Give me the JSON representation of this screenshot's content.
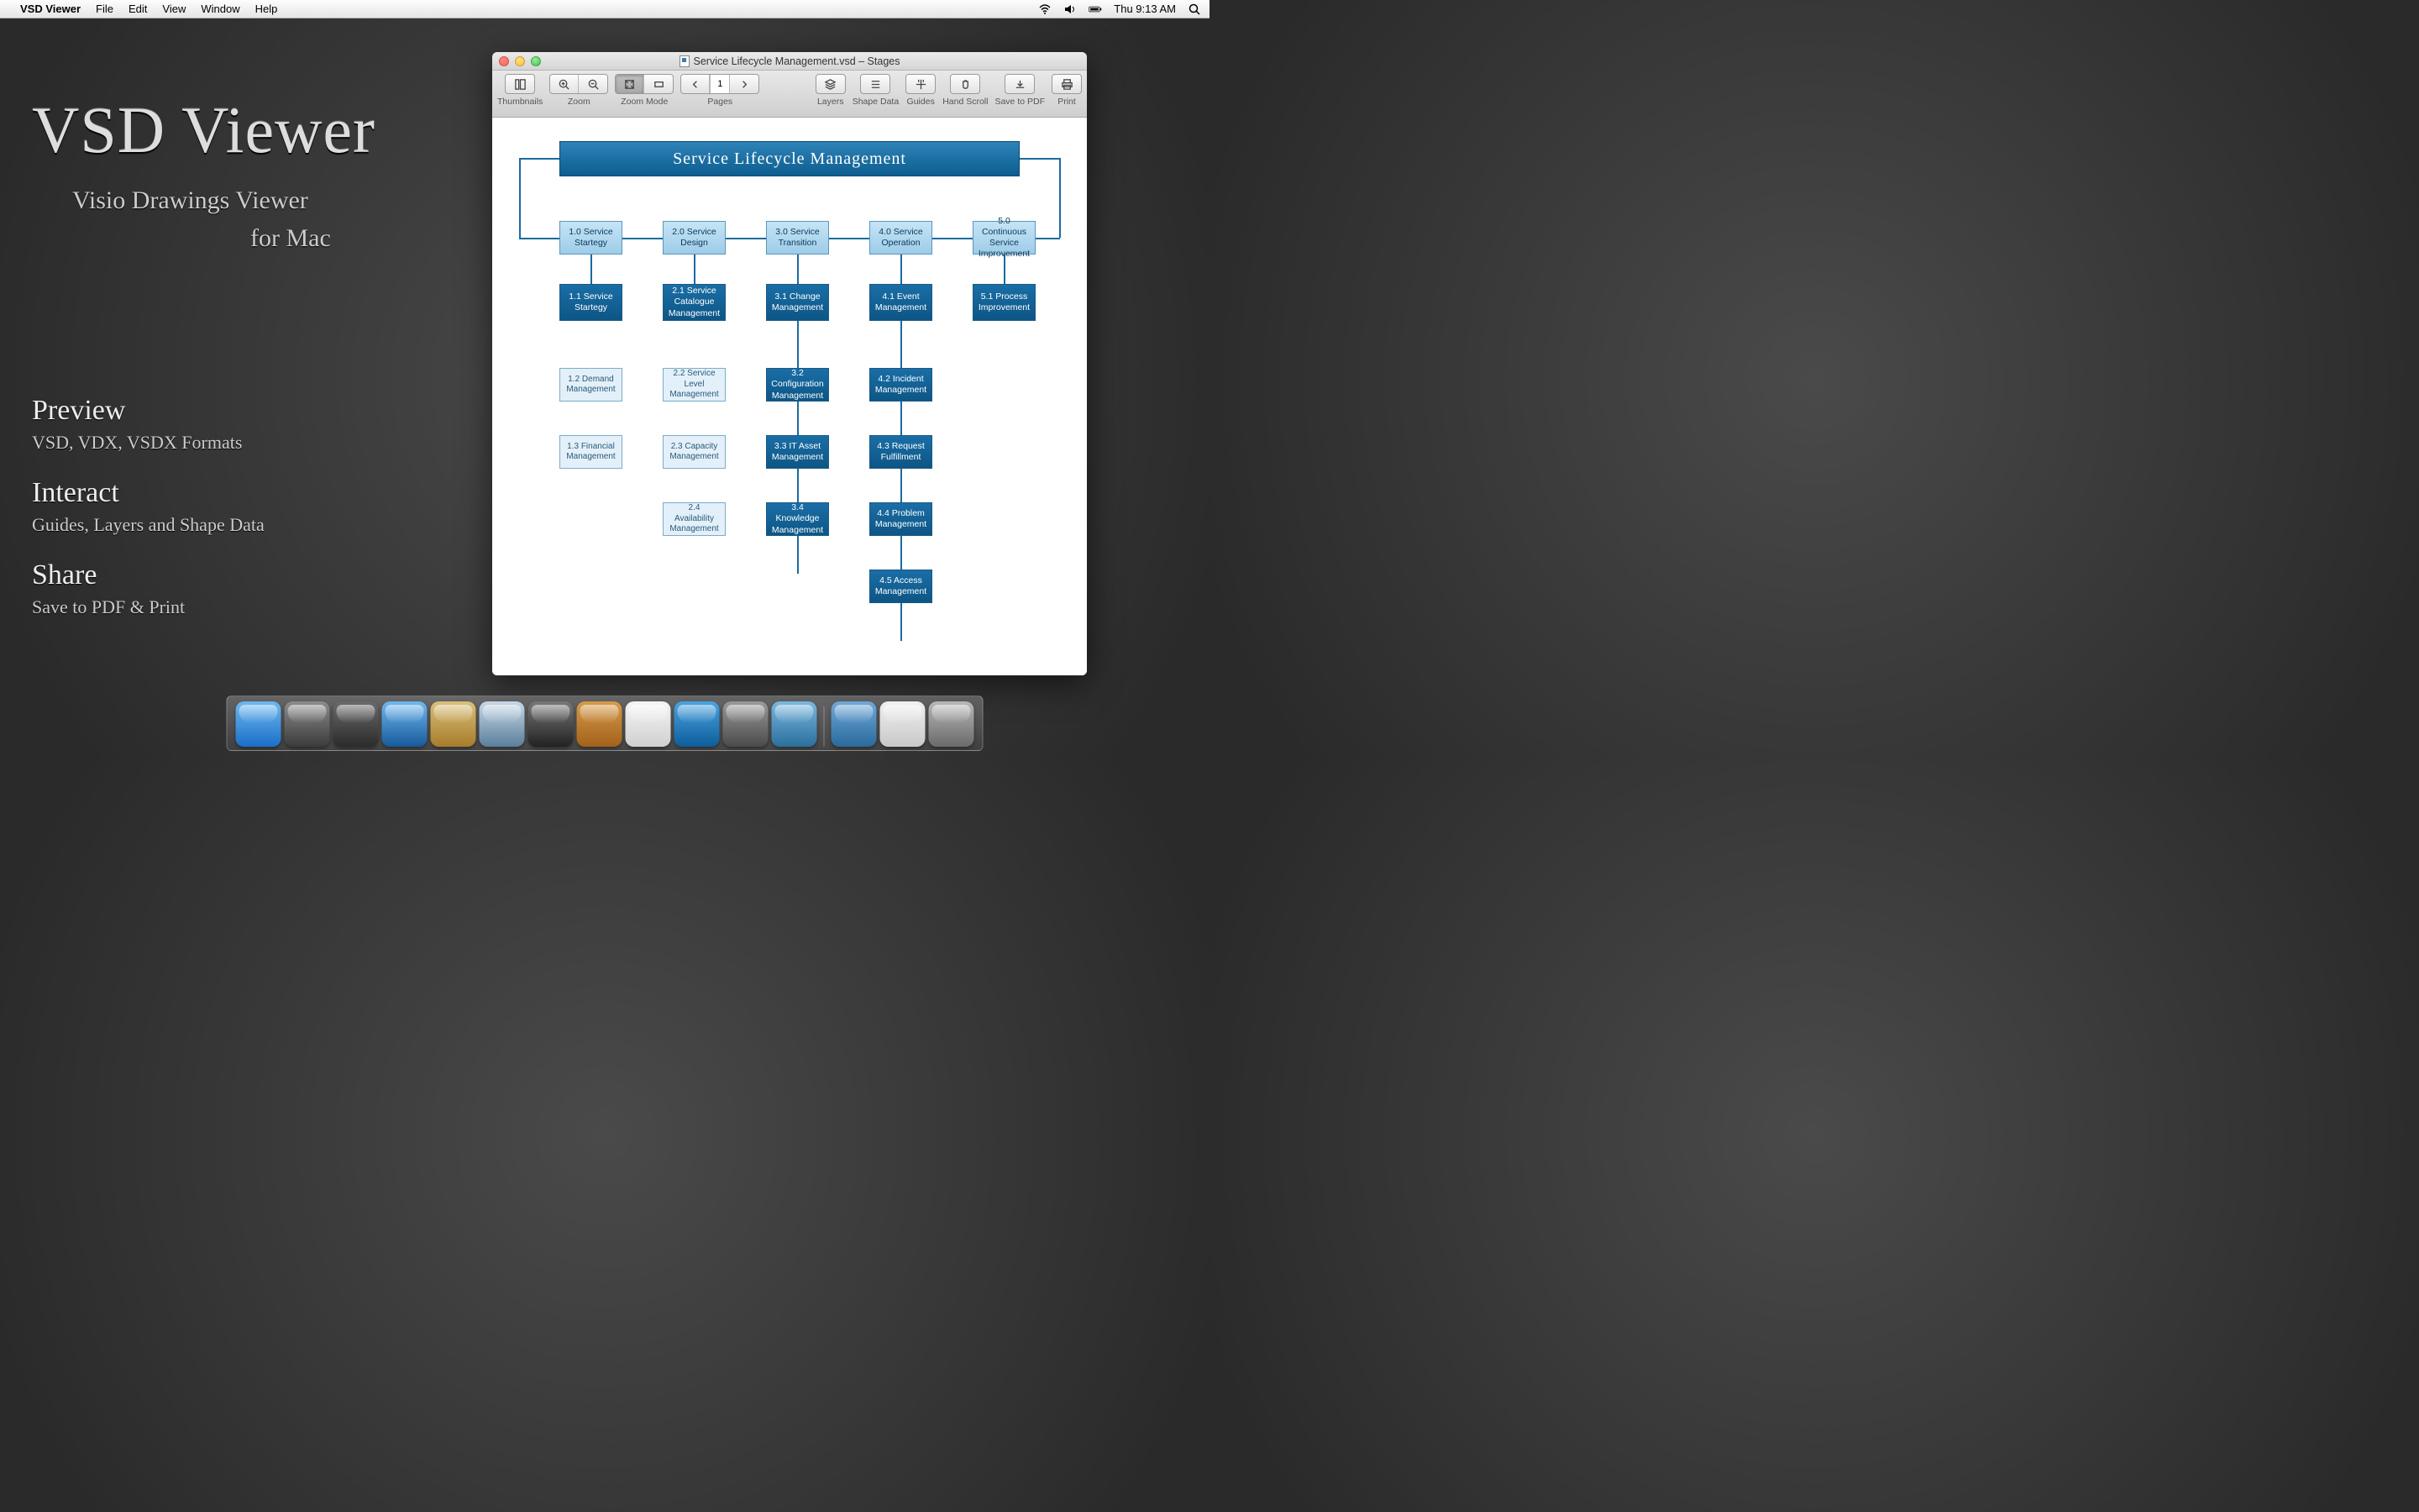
{
  "menubar": {
    "app": "VSD Viewer",
    "items": [
      "File",
      "Edit",
      "View",
      "Window",
      "Help"
    ],
    "clock": "Thu 9:13 AM"
  },
  "promo": {
    "title": "VSD Viewer",
    "subtitle1": "Visio Drawings Viewer",
    "subtitle2": "for Mac",
    "features": [
      {
        "h": "Preview",
        "p": "VSD, VDX, VSDX Formats"
      },
      {
        "h": "Interact",
        "p": "Guides, Layers and Shape Data"
      },
      {
        "h": "Share",
        "p": "Save to PDF & Print"
      }
    ]
  },
  "window": {
    "title": "Service Lifecycle Management.vsd – Stages",
    "toolbar": {
      "thumbnails": "Thumbnails",
      "zoom": "Zoom",
      "zoom_mode": "Zoom Mode",
      "pages": "Pages",
      "page": "1",
      "layers": "Layers",
      "shape_data": "Shape Data",
      "guides": "Guides",
      "hand_scroll": "Hand Scroll",
      "save_pdf": "Save to PDF",
      "print": "Print"
    }
  },
  "diagram": {
    "title": "Service Lifecycle Management",
    "rows": {
      "r1": [
        "1.0 Service Startegy",
        "2.0 Service Design",
        "3.0 Service Transition",
        "4.0 Service Operation",
        "5.0 Continuous Service Improvement"
      ],
      "r2": [
        "1.1 Service Startegy",
        "2.1 Service Catalogue Management",
        "3.1 Change Management",
        "4.1 Event Management",
        "5.1 Process Improvement"
      ],
      "r3": [
        "1.2 Demand Management",
        "2.2 Service Level Management",
        "3.2 Configuration Management",
        "4.2 Incident Management"
      ],
      "r4": [
        "1.3 Financial Management",
        "2.3 Capacity Management",
        "3.3 IT Asset Management",
        "4.3 Request Fulfillment"
      ],
      "r5": [
        "2.4 Availability Management",
        "3.4 Knowledge Management",
        "4.4 Problem Management"
      ],
      "r6": [
        "4.5 Access Management"
      ]
    }
  },
  "dock": {
    "items": [
      {
        "name": "finder",
        "c1": "#6fb8ef",
        "c2": "#1a6fc9"
      },
      {
        "name": "launchpad",
        "c1": "#8c8c8c",
        "c2": "#3b3b3b"
      },
      {
        "name": "mission-control",
        "c1": "#6a6a6a",
        "c2": "#2b2b2b"
      },
      {
        "name": "app-store",
        "c1": "#6fb8ef",
        "c2": "#175a9c"
      },
      {
        "name": "mail",
        "c1": "#d9c07a",
        "c2": "#a77c2a"
      },
      {
        "name": "safari",
        "c1": "#c7d8e6",
        "c2": "#5a7f9c"
      },
      {
        "name": "facetime",
        "c1": "#777",
        "c2": "#222"
      },
      {
        "name": "contacts",
        "c1": "#d89b4a",
        "c2": "#a2611a"
      },
      {
        "name": "calendar",
        "c1": "#f5f5f5",
        "c2": "#d0d0d0"
      },
      {
        "name": "itunes",
        "c1": "#4aa3e0",
        "c2": "#0d5e9b"
      },
      {
        "name": "system-preferences",
        "c1": "#9a9a9a",
        "c2": "#4a4a4a"
      },
      {
        "name": "vsd-viewer",
        "c1": "#7ab8e0",
        "c2": "#2a6f9c"
      }
    ],
    "right": [
      {
        "name": "documents",
        "c1": "#6fa8d8",
        "c2": "#2a6a9c"
      },
      {
        "name": "downloads",
        "c1": "#f0f0f0",
        "c2": "#c8c8c8"
      },
      {
        "name": "trash",
        "c1": "#b8b8b8",
        "c2": "#6a6a6a"
      }
    ]
  }
}
